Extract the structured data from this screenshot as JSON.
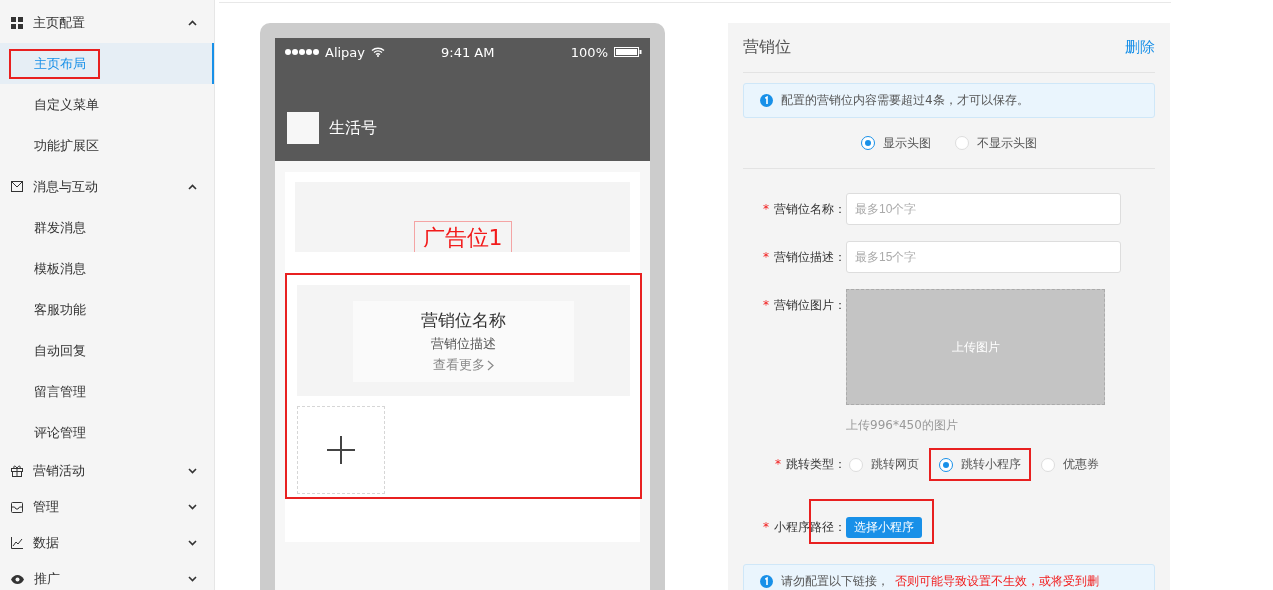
{
  "sidebar": {
    "groups": [
      {
        "label": "主页配置",
        "expanded": true,
        "items": [
          {
            "label": "主页布局",
            "selected": true,
            "highlighted": true
          },
          {
            "label": "自定义菜单",
            "selected": false,
            "highlighted": false
          },
          {
            "label": "功能扩展区",
            "selected": false,
            "highlighted": false
          }
        ]
      },
      {
        "label": "消息与互动",
        "expanded": true,
        "items": [
          {
            "label": "群发消息",
            "selected": false,
            "highlighted": false
          },
          {
            "label": "模板消息",
            "selected": false,
            "highlighted": false
          },
          {
            "label": "客服功能",
            "selected": false,
            "highlighted": false
          },
          {
            "label": "自动回复",
            "selected": false,
            "highlighted": false
          },
          {
            "label": "留言管理",
            "selected": false,
            "highlighted": false
          },
          {
            "label": "评论管理",
            "selected": false,
            "highlighted": false
          }
        ]
      },
      {
        "label": "营销活动",
        "expanded": false
      },
      {
        "label": "管理",
        "expanded": false
      },
      {
        "label": "数据",
        "expanded": false
      },
      {
        "label": "推广",
        "expanded": false
      }
    ]
  },
  "phone": {
    "status_bar": {
      "carrier": "Alipay",
      "time": "9:41 AM",
      "battery": "100%"
    },
    "account_name": "生活号",
    "ad_slot": {
      "label": "广告位1"
    },
    "marketing_block": {
      "highlighted": true,
      "title": "营销位名称",
      "description": "营销位描述",
      "more": "查看更多"
    }
  },
  "panel": {
    "title": "营销位",
    "delete": "删除",
    "notice": "配置的营销位内容需要超过4条，才可以保存。",
    "header_image_options": [
      {
        "label": "显示头图",
        "selected": true
      },
      {
        "label": "不显示头图",
        "selected": false
      }
    ],
    "fields": [
      {
        "kind": "input",
        "required_mark": "*",
        "label": "营销位名称：",
        "placeholder": "最多10个字"
      },
      {
        "kind": "input",
        "required_mark": "*",
        "label": "营销位描述：",
        "placeholder": "最多15个字"
      },
      {
        "kind": "upload",
        "required_mark": "*",
        "label": "营销位图片：",
        "button": "上传图片",
        "hint": "上传996*450的图片"
      },
      {
        "kind": "radio",
        "required_mark": "*",
        "label": "跳转类型：",
        "options": [
          {
            "label": "跳转网页",
            "selected": false,
            "highlighted": false
          },
          {
            "label": "跳转小程序",
            "selected": true,
            "highlighted": true
          },
          {
            "label": "优惠券",
            "selected": false,
            "highlighted": false
          }
        ]
      },
      {
        "kind": "button",
        "required_mark": "*",
        "label": "小程序路径：",
        "button": "选择小程序",
        "highlighted": true
      }
    ],
    "warning": {
      "text": "请勿配置以下链接，",
      "alert": "否则可能导致设置不生效，或将受到删"
    }
  }
}
